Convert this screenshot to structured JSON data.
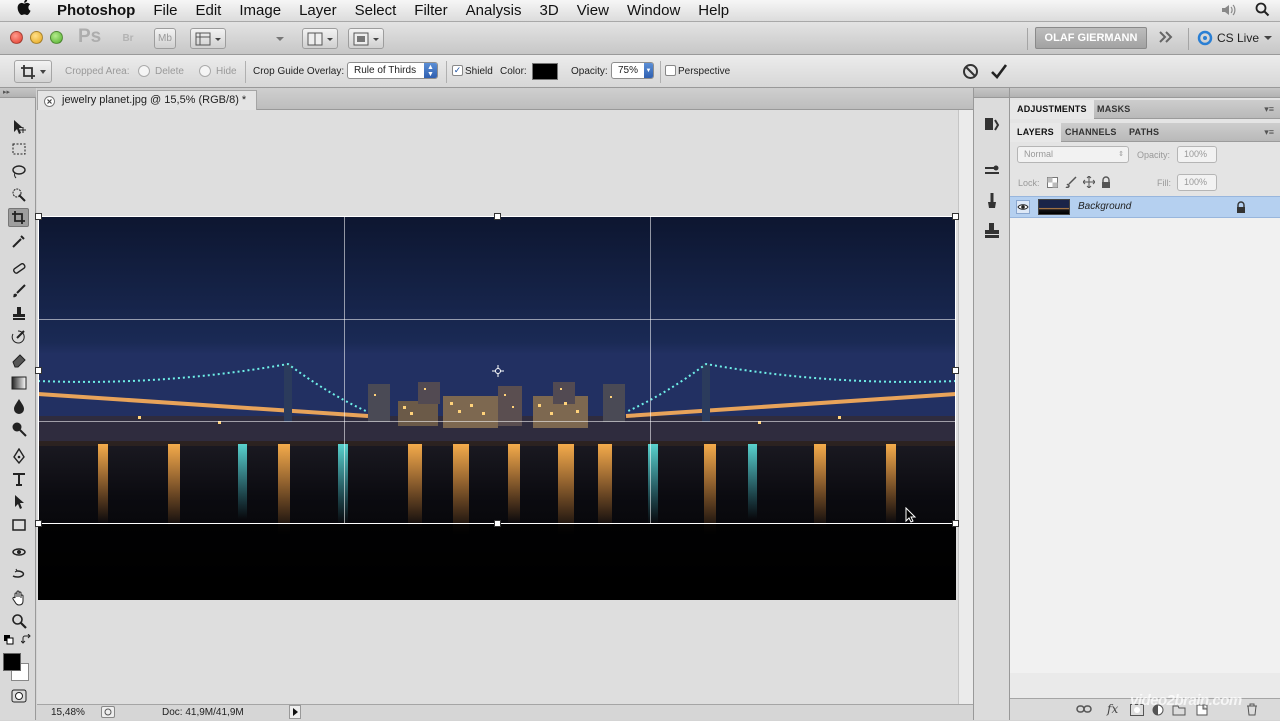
{
  "menubar": {
    "app": "Photoshop",
    "items": [
      "File",
      "Edit",
      "Image",
      "Layer",
      "Select",
      "Filter",
      "Analysis",
      "3D",
      "View",
      "Window",
      "Help"
    ]
  },
  "appbar": {
    "ps_logo": "Ps",
    "br_label": "Br",
    "mb_label": "Mb",
    "user": "OLAF GIERMANN",
    "cs_live": "CS Live"
  },
  "options": {
    "cropped_area_label": "Cropped Area:",
    "delete_label": "Delete",
    "hide_label": "Hide",
    "overlay_label": "Crop Guide Overlay:",
    "overlay_value": "Rule of Thirds",
    "shield_label": "Shield",
    "shield_checked": "✓",
    "color_label": "Color:",
    "shield_color": "#000000",
    "opacity_label": "Opacity:",
    "opacity_value": "75%",
    "perspective_label": "Perspective"
  },
  "document": {
    "tab_title": "jewelry planet.jpg @ 15,5% (RGB/8) *"
  },
  "status": {
    "zoom": "15,48%",
    "doc_info": "Doc: 41,9M/41,9M"
  },
  "panels": {
    "top_tabs": [
      "ADJUSTMENTS",
      "MASKS"
    ],
    "layer_tabs": [
      "LAYERS",
      "CHANNELS",
      "PATHS"
    ],
    "blend_mode": "Normal",
    "opacity_label": "Opacity:",
    "opacity_value": "100%",
    "lock_label": "Lock:",
    "fill_label": "Fill:",
    "fill_value": "100%",
    "layer_name": "Background"
  },
  "watermark": "video2brain.com",
  "colors": {
    "foreground": "#000000",
    "background": "#ffffff",
    "selected_layer": "#b5d0f0"
  }
}
